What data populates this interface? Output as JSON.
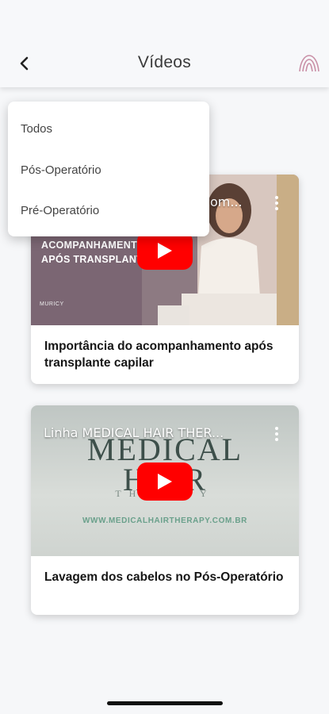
{
  "header": {
    "title": "Vídeos",
    "back_icon": "chevron-left-icon",
    "logo_icon": "clinic-logo-icon"
  },
  "filter_menu": {
    "items": [
      {
        "label": "Todos"
      },
      {
        "label": "Pós-Operatório"
      },
      {
        "label": "Pré-Operatório"
      }
    ]
  },
  "videos": [
    {
      "player_title": "om...",
      "thumbnail_text": [
        "ACOMPANHAMENTO",
        "APÓS TRANSPLANTE"
      ],
      "brand": "MURICY",
      "title": "Importância do acompanhamento após transplante capilar"
    },
    {
      "player_title": "Linha MEDICAL HAIR THER...",
      "thumbnail_lines": [
        "MEDICAL",
        "HAIR",
        "THERAPY"
      ],
      "thumbnail_url": "WWW.MEDICALHAIRTHERAPY.COM.BR",
      "title": "Lavagem dos cabelos no Pós-Operatório"
    }
  ],
  "colors": {
    "youtube_red": "#ff0000",
    "logo_pink": "#c98fa6"
  }
}
